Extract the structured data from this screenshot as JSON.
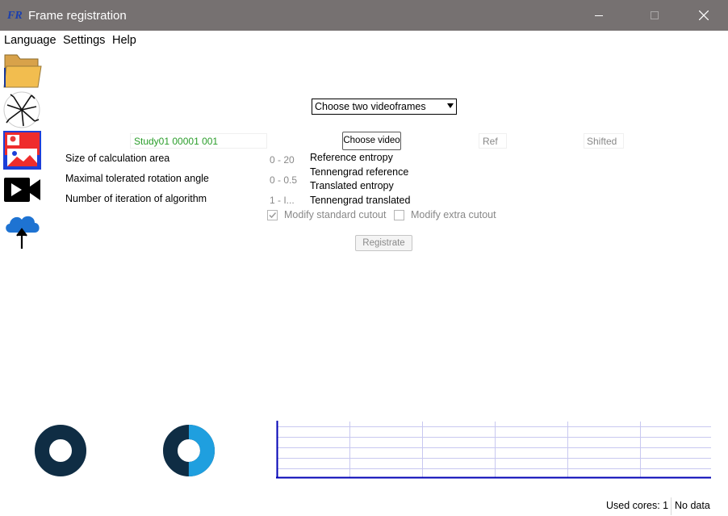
{
  "window": {
    "title": "Frame registration",
    "minimize_glyph": "—",
    "maximize_glyph": "☐",
    "close_glyph": "✕"
  },
  "menu": {
    "items": [
      "Language",
      "Settings",
      "Help"
    ]
  },
  "toolbar": {
    "icons": [
      "folder-icon",
      "crack-pattern-icon",
      "image-overlay-icon",
      "video-camera-icon",
      "cloud-upload-icon"
    ]
  },
  "frames": {
    "select_value": "Choose two videoframes"
  },
  "video": {
    "study_value": "Study01  00001  001",
    "choose_video_label": "Choose video",
    "ref_placeholder": "Ref",
    "shifted_placeholder": "Shifted"
  },
  "params": [
    {
      "label": "Size of calculation area",
      "placeholder": "0 - 20"
    },
    {
      "label": "Maximal tolerated rotation angle",
      "placeholder": "0 - 0.5"
    },
    {
      "label": "Number of iteration of algorithm",
      "placeholder": "1 - I..."
    }
  ],
  "info": {
    "reference_entropy": "Reference entropy",
    "tennengrad_reference": "Tennengrad reference",
    "translated_entropy": "Translated entropy",
    "tennengrad_translated": "Tennengrad translated"
  },
  "options": {
    "modify_standard_cutout": {
      "label": "Modify standard cutout",
      "checked": true
    },
    "modify_extra_cutout": {
      "label": "Modify extra cutout",
      "checked": false
    }
  },
  "actions": {
    "registrate_label": "Registrate"
  },
  "progress": {
    "donut_1_fraction": 0,
    "donut_2_fraction": 0.5
  },
  "status": {
    "used_cores": "Used cores: 1",
    "data_status": "No data"
  },
  "colors": {
    "titlebar": "#767171",
    "donut_track": "#0f2d44",
    "donut_fill": "#1f9fdf",
    "plot_axis": "#0000b4",
    "plot_grid": "#c8c8f0",
    "study_text": "#2a9d2a"
  }
}
